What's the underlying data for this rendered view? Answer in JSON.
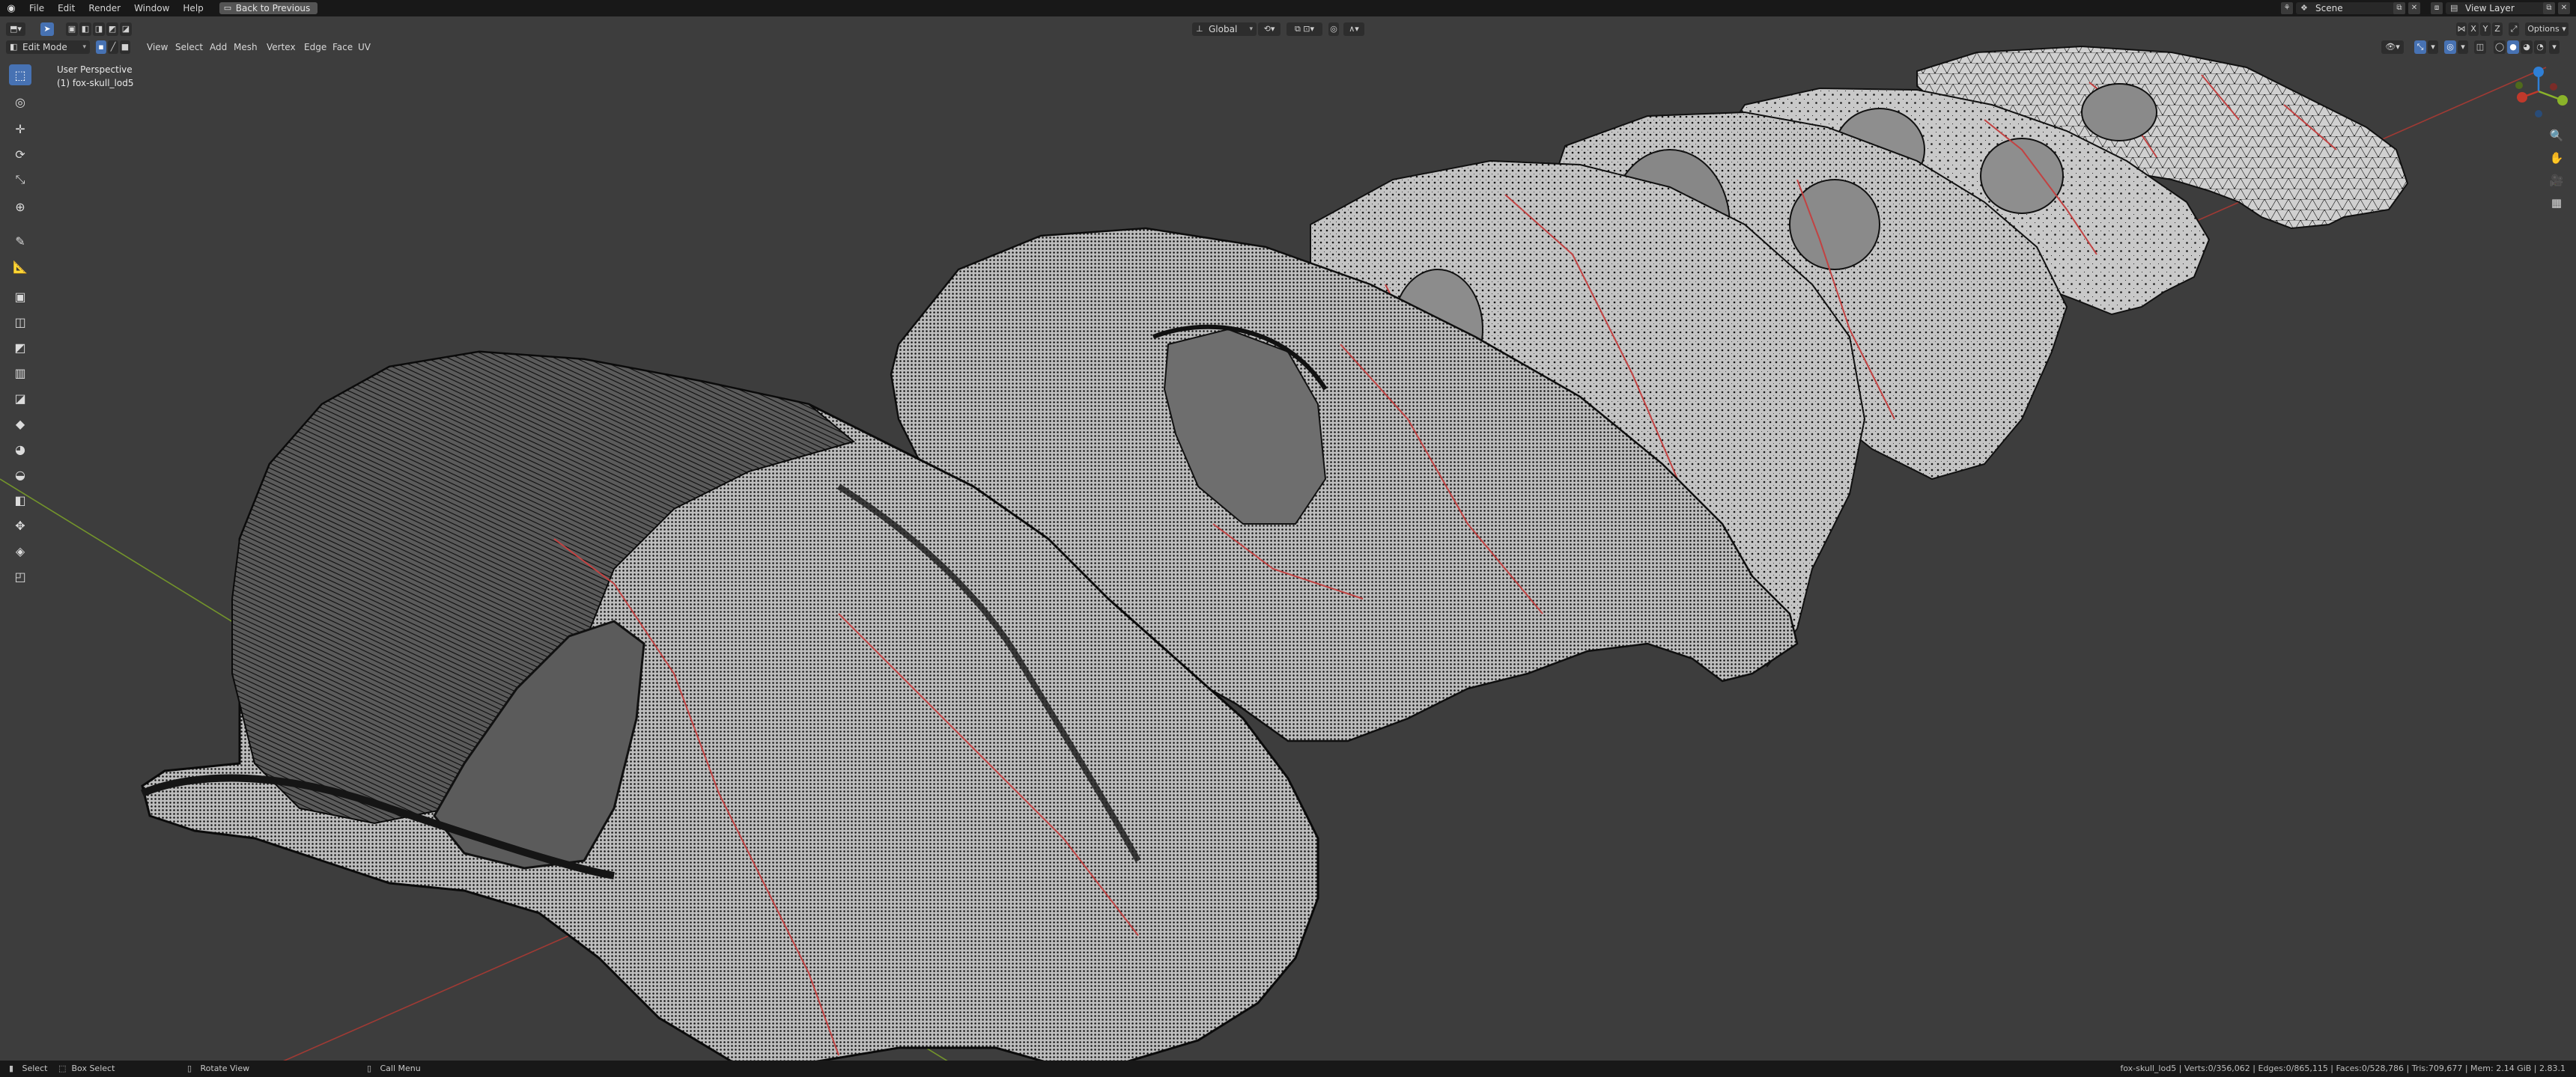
{
  "topbar": {
    "menus": [
      "File",
      "Edit",
      "Render",
      "Window",
      "Help"
    ],
    "back_button": "Back to Previous",
    "scene_label": "Scene",
    "view_layer_label": "View Layer"
  },
  "header": {
    "mode": "Edit Mode",
    "menus": [
      "View",
      "Select",
      "Add",
      "Mesh",
      "Vertex",
      "Edge",
      "Face",
      "UV"
    ],
    "orientation": "Global",
    "options_label": "Options"
  },
  "viewport": {
    "perspective_label": "User Perspective",
    "object_label": "(1) fox-skull_lod5",
    "axis_colors": {
      "x": "#c0392b",
      "y": "#8ab32a",
      "z": "#2f7fd6"
    }
  },
  "toolbar": {
    "tools": [
      {
        "icon": "select-box-icon",
        "glyph": "⬚"
      },
      {
        "icon": "cursor-icon",
        "glyph": "◎"
      },
      {
        "icon": "move-icon",
        "glyph": "✛"
      },
      {
        "icon": "rotate-icon",
        "glyph": "⟳"
      },
      {
        "icon": "scale-icon",
        "glyph": "⤡"
      },
      {
        "icon": "transform-icon",
        "glyph": "⊕"
      },
      {
        "icon": "annotate-icon",
        "glyph": "✎"
      },
      {
        "icon": "measure-icon",
        "glyph": "📐"
      },
      {
        "icon": "extrude-icon",
        "glyph": "▣"
      },
      {
        "icon": "inset-icon",
        "glyph": "◫"
      },
      {
        "icon": "bevel-icon",
        "glyph": "◩"
      },
      {
        "icon": "loop-cut-icon",
        "glyph": "▥"
      },
      {
        "icon": "knife-icon",
        "glyph": "◪"
      },
      {
        "icon": "poly-build-icon",
        "glyph": "◆"
      },
      {
        "icon": "spin-icon",
        "glyph": "◕"
      },
      {
        "icon": "smooth-icon",
        "glyph": "◒"
      },
      {
        "icon": "edge-slide-icon",
        "glyph": "◧"
      },
      {
        "icon": "shrink-fatten-icon",
        "glyph": "✥"
      },
      {
        "icon": "shear-icon",
        "glyph": "◈"
      },
      {
        "icon": "rip-region-icon",
        "glyph": "◰"
      }
    ]
  },
  "statusbar": {
    "select": "Select",
    "box_select": "Box Select",
    "rotate_view": "Rotate View",
    "call_menu": "Call Menu",
    "stats": "fox-skull_lod5 | Verts:0/356,062 | Edges:0/865,115 | Faces:0/528,786 | Tris:709,677 | Mem: 2.14 GiB | 2.83.1"
  }
}
